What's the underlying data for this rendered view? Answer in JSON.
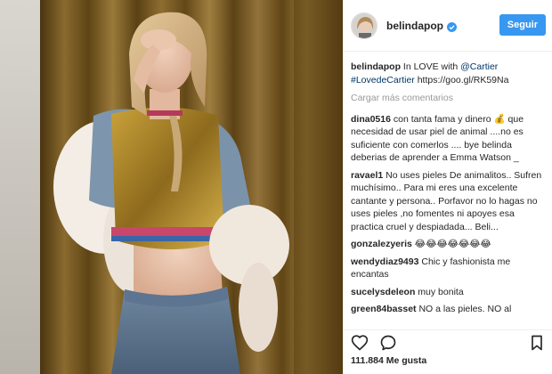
{
  "post": {
    "username": "belindapop",
    "follow_label": "Seguir",
    "caption": {
      "text_before_mention": "In LOVE with ",
      "mention": "@Cartier",
      "hashtag": "#LovedeCartier",
      "link": "https://goo.gl/RK59Na"
    },
    "load_more_label": "Cargar más comentarios",
    "comments": [
      {
        "user": "dina0516",
        "text": "con tanta fama y dinero 💰 que necesidad de usar piel de animal ....no es suficiente con comerlos .... bye belinda deberias de aprender a Emma Watson _"
      },
      {
        "user": "ravael1",
        "text": "No uses pieles De animalitos.. Sufren muchísimo.. Para mi eres una excelente cantante y persona.. Porfavor no lo hagas no uses pieles ,no fomentes ni apoyes esa practica cruel y despiadada... Beli..."
      },
      {
        "user": "gonzalezyeris",
        "text": "😂😂😂😂😂😂😂"
      },
      {
        "user": "wendydiaz9493",
        "text": "Chic y fashionista me encantas"
      },
      {
        "user": "sucelysdeleon",
        "text": "muy bonita"
      },
      {
        "user": "green84basset",
        "text": "NO a las pieles. NO al"
      }
    ],
    "likes_count": "111.884",
    "likes_suffix": "Me gusta"
  },
  "icons": {
    "like": "heart-icon",
    "comment": "comment-bubble-icon",
    "save": "bookmark-icon",
    "verified": "verified-badge-icon"
  },
  "colors": {
    "follow_button": "#3897f0",
    "verified": "#3897f0",
    "link": "#003569",
    "muted": "#999999"
  }
}
